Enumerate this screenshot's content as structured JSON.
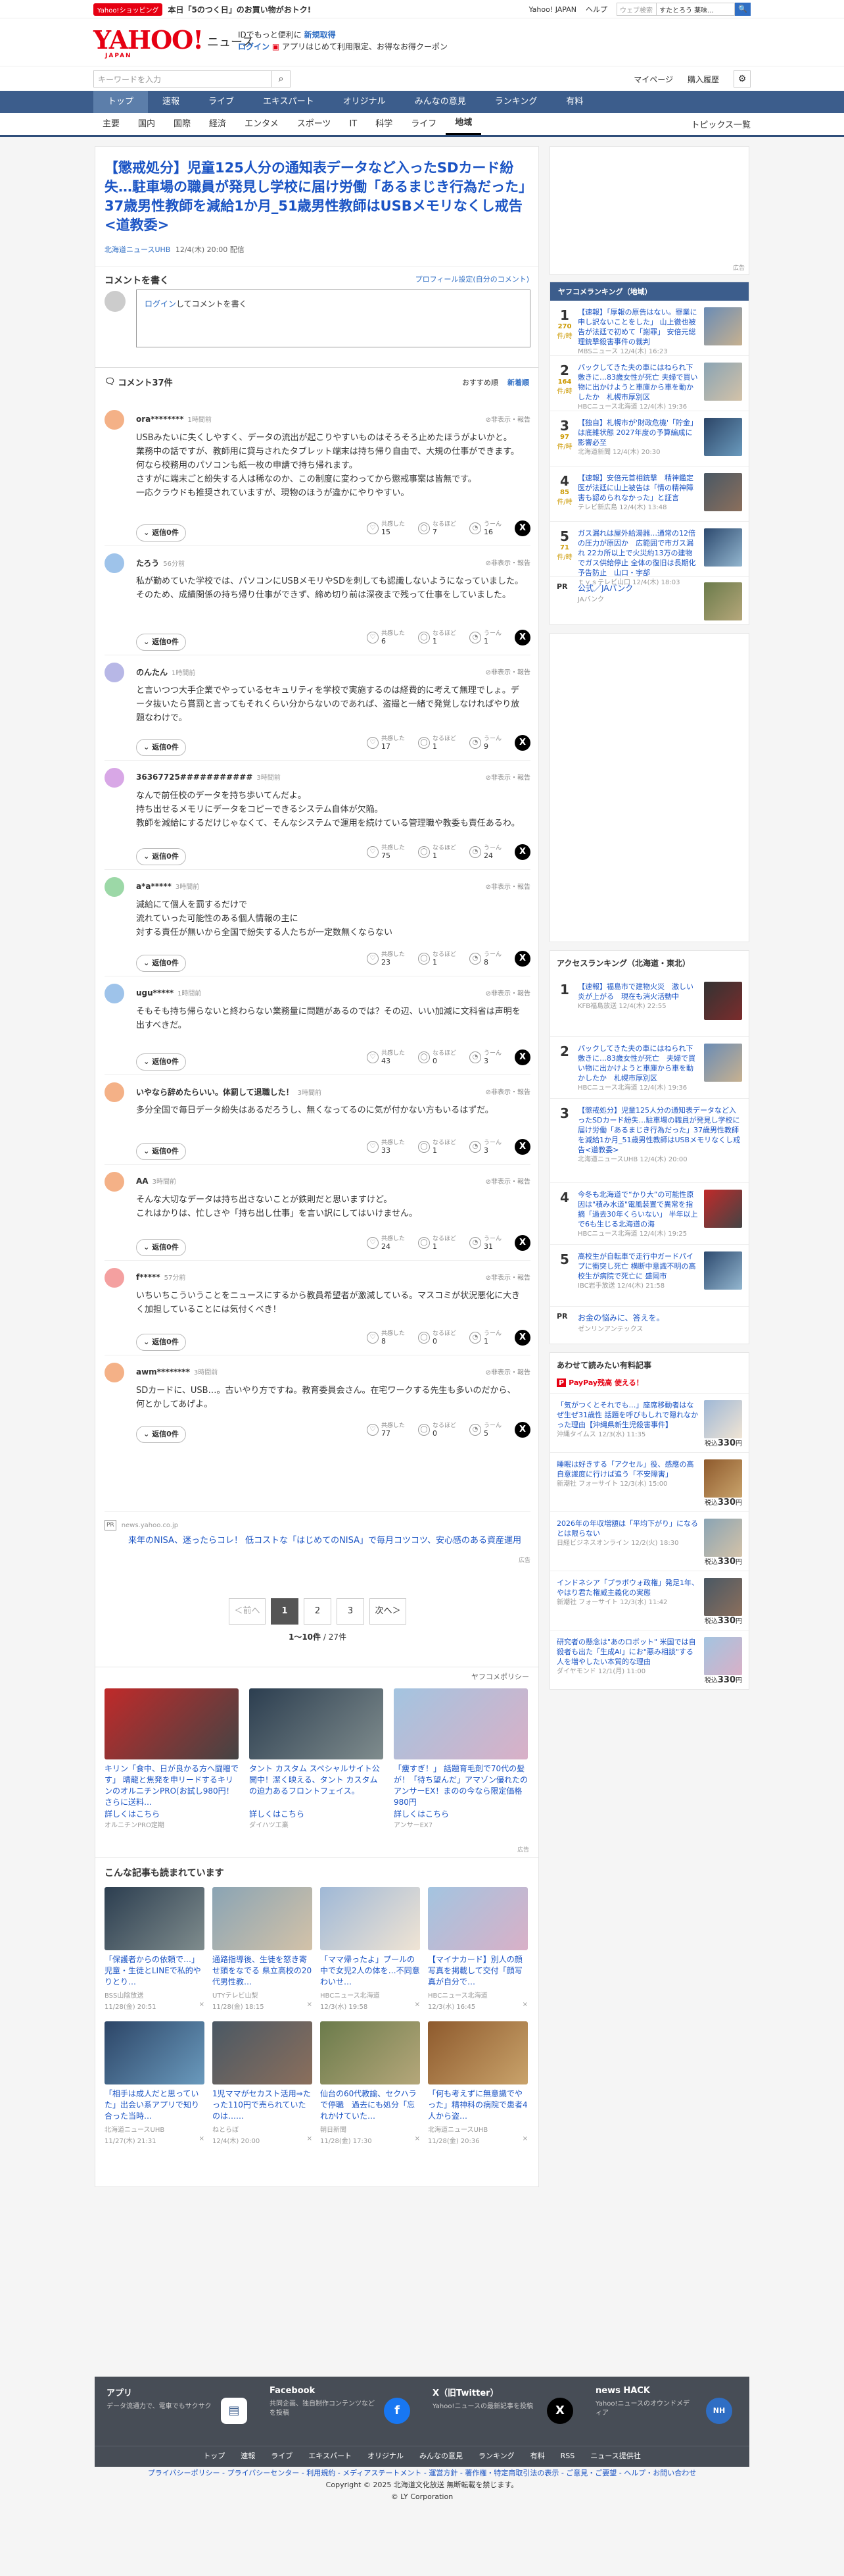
{
  "promo": {
    "tag": "Yahoo!ショッピング",
    "text": "本日「5のつく日」のお買い物がおトク!"
  },
  "topbar": {
    "link1": "Yahoo! JAPAN",
    "link2": "ヘルプ",
    "search_ph": "ウェブ検索",
    "search_value": "すたとろう 薬味…",
    "search_btn": "🔍"
  },
  "header": {
    "logo": "YAHOO!",
    "logo_sub": "JAPAN",
    "service": "ニュース",
    "msg1": "IDでもっと便利に",
    "msg1b": "新規取得",
    "msg2a": "ログイン",
    "msg2b": "アプリはじめて利用限定、お得なお得クーポン"
  },
  "search": {
    "placeholder": "キーワードを入力",
    "mypage": "マイページ",
    "history": "購入履歴"
  },
  "gnav": [
    "トップ",
    "速報",
    "ライブ",
    "エキスパート",
    "オリジナル",
    "みんなの意見",
    "ランキング",
    "有料"
  ],
  "snav": [
    "主要",
    "国内",
    "国際",
    "経済",
    "エンタメ",
    "スポーツ",
    "IT",
    "科学",
    "ライフ",
    "地域"
  ],
  "snav_right": "トピックス一覧",
  "article": {
    "title": "【懲戒処分】児童125人分の通知表データなど入ったSDカード紛失…駐車場の職員が発見し学校に届け労働「あるまじき行為だった」37歳男性教師を減給1か月_51歳男性教師はUSBメモリなくし戒告<道教委>",
    "source": "北海道ニュースUHB",
    "date": "12/4(木) 20:00",
    "kind": "配信"
  },
  "compose": {
    "head": "コメントを書く",
    "profile": "プロフィール設定(自分のコメント)",
    "login": "ログイン",
    "rest": "してコメントを書く"
  },
  "clist": {
    "title": "コメント37件",
    "sort1": "おすすめ順",
    "sort2": "新着順"
  },
  "labels": {
    "reply": "返信0件",
    "report": "非表示・報告",
    "like": "共感した",
    "hmm": "なるほど",
    "well": "うーん",
    "pr": "PR"
  },
  "comments": [
    {
      "name": "ora********",
      "time": "1時間前",
      "color": "#f4b187",
      "body": "USBみたいに失くしやすく、データの流出が起こりやすいものはそろそろ止めたほうがよいかと。\n業務中の話ですが、教師用に貸与されたタブレット端末は持ち帰り自由で、大規の仕事ができます。何なら校務用のパソコンも紙一枚の申請で持ち帰れます。\nさすがに端末ごと紛失する人は稀なのか、この制度に変わってから懲戒事案は皆無です。\n一応クラウドも推奨されていますが、現物のほうが違かにやりやすい。",
      "likes": "15",
      "hmm": "7",
      "well": "16"
    },
    {
      "name": "たろう",
      "time": "56分前",
      "color": "#9ec3ea",
      "body": "私が勤めていた学校では、パソコンにUSBメモリやSDを刺しても認識しないようになっていました。\nそのため、成績関係の持ち帰り仕事ができず、締め切り前は深夜まで残って仕事をしていました。",
      "likes": "6",
      "hmm": "1",
      "well": "1"
    },
    {
      "name": "のんたん",
      "time": "1時間前",
      "color": "#b7b7e6",
      "body": "と言いつつ大手企業でやっているセキュリティを学校で実施するのは経費的に考えて無理でしょ。データ抜いたら賞罰と言ってもそれくらい分からないのであれば、盗撮と一緒で発覚しなければやり放題なわけで。",
      "likes": "17",
      "hmm": "1",
      "well": "9"
    },
    {
      "name": "36367725###########",
      "time": "3時間前",
      "color": "#d8a7e6",
      "body": "なんで前任校のデータを持ち歩いてんだよ。\n持ち出せるメモリにデータをコピーできるシステム自体が欠陥。\n教師を減給にするだけじゃなくて、そんなシステムで運用を続けている管理職や教委も責任あるわ。",
      "likes": "75",
      "hmm": "1",
      "well": "24"
    },
    {
      "name": "a*a*****",
      "time": "3時間前",
      "color": "#9cd8a7",
      "body": "減給にて個人を罰するだけで\n流れていった可能性のある個人情報の主に\n対する責任が無いから全国で紛失する人たちが一定数無くならない",
      "likes": "23",
      "hmm": "1",
      "well": "8"
    },
    {
      "name": "ugu*****",
      "time": "1時間前",
      "color": "#9ec3ea",
      "body": "そもそも持ち帰らないと終わらない業務量に問題があるのでは？その辺、いい加減に文科省は声明を出すべきだ。",
      "likes": "43",
      "hmm": "0",
      "well": "3"
    },
    {
      "name": "いやなら辞めたらいい。体罰して退職した！",
      "time": "3時間前",
      "color": "#f4b187",
      "body": "多分全国で毎日データ紛失はあるだろうし、無くなってるのに気が付かない方もいるはずだ。",
      "likes": "33",
      "hmm": "1",
      "well": "3"
    },
    {
      "name": "AA",
      "time": "3時間前",
      "color": "#f4b187",
      "body": "そんな大切なデータは持ち出さないことが鉄則だと思いますけど。\nこれはかりは、忙しさや「持ち出し仕事」を言い訳にしてはいけません。",
      "likes": "24",
      "hmm": "1",
      "well": "31"
    },
    {
      "name": "f*****",
      "time": "57分前",
      "color": "#f4a0a0",
      "body": "いちいちこういうことをニュースにするから教員希望者が激減している。マスコミが状況悪化に大きく加担していることには気付くべき！",
      "likes": "8",
      "hmm": "0",
      "well": "1"
    },
    {
      "name": "awm********",
      "time": "3時間前",
      "color": "#f4b187",
      "body": "SDカードに、USB…。古いやり方ですね。教育委員会さん。在宅ワークする先生も多いのだから、何とかしてあげよ。",
      "likes": "77",
      "hmm": "0",
      "well": "5"
    }
  ],
  "ad1": {
    "domain": "news.yahoo.co.jp",
    "text": "来年のNISA、迷ったらコレ！ 低コストな「はじめてのNISA」で毎月コツコツ、安心感のある資産運用",
    "pr": "広告"
  },
  "pager": {
    "prev": "＜前へ",
    "next": "次へ＞",
    "p1": "1",
    "p2": "2",
    "p3": "3",
    "count": "1〜10件",
    "total": "27件"
  },
  "policy": "ヤフコメポリシー",
  "ads": [
    {
      "title": "キリン「食中、日が良かる方へ闘贈です」 晴龍と焦発を申リードするキリンのオルニチンPRO(お試し980円！さらに送料…",
      "link": "詳しくはこちら",
      "by": "オルニチンPRO定期",
      "theme": "g6"
    },
    {
      "title": "タント カスタム スペシャルサイト公開中！潔く映える、タント カスタムの迫力あるフロントフェイス。",
      "link": "詳しくはこちら",
      "by": "ダイハツ工業",
      "theme": "g10"
    },
    {
      "title": "「痩すぎ！」 話題育毛剤で70代の髪が！「待ち望んだ」アマゾン優れたのアンサーEX！まのの今なら限定価格980円",
      "link": "詳しくはこちら",
      "by": "アンサーEX7",
      "theme": "g11"
    }
  ],
  "adlabel": "広告",
  "read": {
    "head": "こんな記事も読まれています",
    "items": [
      {
        "title": "「保護者からの依頼で…」児童・生徒とLINEで私的やりとり…",
        "src": "BSS山陰放送",
        "date": "11/28(金) 20:51"
      },
      {
        "title": "通路指導後、生徒を怒き寄せ頭をなでる 県立高校の20代男性教…",
        "src": "UTYテレビ山梨",
        "date": "11/28(金) 18:15"
      },
      {
        "title": "「ママ帰ったよ」プールの中で女児2人の体を…不同意わいせ…",
        "src": "HBCニュース北海道",
        "date": "12/3(水) 19:58"
      },
      {
        "title": "【マイナカード】別人の顔写真を掲載して交付「顔写真が自分で…",
        "src": "HBCニュース北海道",
        "date": "12/3(水) 16:45"
      },
      {
        "title": "「相手は成人だと思っていた」出会い系アプリで知り合った当時…",
        "src": "北海道ニュースUHB",
        "date": "11/27(木) 21:31"
      },
      {
        "title": "1児ママがセカスト活用⇒たった110円で売られていたのは……",
        "src": "ねとらぼ",
        "date": "12/4(木) 20:00"
      },
      {
        "title": "仙台の60代教諭、セクハラで停職　過去にも処分「忘れかけていた…",
        "src": "朝日新聞",
        "date": "11/28(金) 17:30"
      },
      {
        "title": "「何も考えずに無意識でやった」精神科の病院で患者4人から盗…",
        "src": "北海道ニュースUHB",
        "date": "11/28(金) 20:36"
      }
    ]
  },
  "side": {
    "ad_label": "広告",
    "r1_head": "ヤフコメランキング（地域）",
    "r1": [
      {
        "n": "1",
        "count": "270",
        "unit": "件/時",
        "text": "【速報】「厚報の原告はない。罪業に申し訳ないことをした」 山上徹也被告が法廷で初めて「謝罪」 安倍元総理銃撃殺害事件の裁判",
        "src": "MBSニュース 12/4(木) 16:23"
      },
      {
        "n": "2",
        "count": "164",
        "unit": "件/時",
        "text": "パックしてきた夫の車にはねられ下敷きに…83歳女性が死亡 夫婦で買い物に出かけようと車庫から車を動かしたか　札幌市厚別区",
        "src": "HBCニュース北海道 12/4(木) 19:36"
      },
      {
        "n": "3",
        "count": "97",
        "unit": "件/時",
        "text": "【独自】札幌市が'財政危機'「貯金」は底雑状態 2027年度の予算編成に影響必至",
        "src": "北海道新聞 12/4(木) 20:30"
      },
      {
        "n": "4",
        "count": "85",
        "unit": "件/時",
        "text": "【速報】安倍元首相銃撃　精神鑑定医が法廷に山上被告は「情の精神障害も認められなかった」と証言",
        "src": "テレビ新広島 12/4(木) 13:48"
      },
      {
        "n": "5",
        "count": "71",
        "unit": "件/時",
        "text": "ガス漏れは屋外給湯器…通常の12倍の圧力が原因か　広範囲で市ガス漏れ 22カ所以上で火災約13万の建物でガス供給停止 全体の復旧は長期化予告防止　山口・宇部",
        "src": "ｔｙｓテレビ山口 12/4(木) 18:03"
      }
    ],
    "pr1": {
      "name": "公式／JAバンク",
      "sub": "JAバンク"
    },
    "r2_head": "アクセスランキング（北海道・東北）",
    "r2": [
      {
        "n": "1",
        "text": "【速報】福島市で建物火災　激しい炎が上がる　現在も消火活動中",
        "src": "KFB福島放送 12/4(木) 22:55"
      },
      {
        "n": "2",
        "text": "パックしてきた夫の車にはねられ下敷きに…83歳女性が死亡　夫婦で買い物に出かけようと車庫から車を動かしたか　札幌市厚別区",
        "src": "HBCニュース北海道 12/4(木) 19:36"
      },
      {
        "n": "3",
        "text": "【懲戒処分】児童125人分の通知表データなど入ったSDカード紛失…駐車場の職員が発見し学校に届け労働「あるまじき行為だった」37歳男性教師を減給1か月_51歳男性教師はUSBメモリなくし戒告<道教委>",
        "src": "北海道ニュースUHB 12/4(木) 20:00"
      },
      {
        "n": "4",
        "text": "今冬も北海道で“かり大”の可能性原因は\"積み水道\"電風装置で異常を指摘「過去30年くらいない」 半年以上で6も生じる北海道の海",
        "src": "HBCニュース北海道 12/4(木) 19:25"
      },
      {
        "n": "5",
        "text": "高校生が自転車で走行中ガードパイプに衝突し死亡 横断中意識不明の高校生が病院で死亡に 盛岡市",
        "src": "IBC岩手放送 12/4(木) 21:58"
      }
    ],
    "pr2": {
      "name": "お金の悩みに、答えを。",
      "sub": "ゼンリンアンテックス"
    },
    "r3_head": "あわせて読みたい有料記事",
    "paypay": "PayPay残高 使える！",
    "paid": [
      {
        "title": "「気がつくとそれでも…」座席移動者はなぜ生ぜ31歳性 話題を呼びもしれで隠れなかった理由【沖縄県新生児殺害事件】",
        "src": "沖縄タイムス 12/3(水) 11:35",
        "price": "330"
      },
      {
        "title": "睡眠は好きする「アクセル」役、感應の高自意識度に行けば追う「不安障害」",
        "src": "新潮社 フォーサイト 12/3(水) 15:00",
        "price": "330"
      },
      {
        "title": "2026年の年収増額は「平均下がり」になるとは限らない",
        "src": "日経ビジネスオンライン 12/2(火) 18:30",
        "price": "330"
      },
      {
        "title": "インドネシア「プラボウォ政権」発足1年、やはり君た権威主義化の実態",
        "src": "新潮社 フォーサイト 12/3(水) 11:42",
        "price": "330"
      },
      {
        "title": "研究者の懸念は\"あのロボット\" 米国では自殺者も出た「生成AI」にお\"悪み相談\"する人を増やしたい本質的な理由",
        "src": "ダイヤモンド 12/1(月) 11:00",
        "price": "330"
      }
    ],
    "price_prefix": "税込",
    "price_unit": "円"
  },
  "footer": {
    "app_t": "アプリ",
    "app_d": "データ流通力で、電車でもサクサク",
    "fb_t": "Facebook",
    "fb_d": "共同企画、独自制作コンテンツなどを投稿",
    "x_t": "X（旧Twitter）",
    "x_d": "Yahoo!ニュースの最新記事を投稿",
    "hack_t": "news HACK",
    "hack_d": "Yahoo!ニュースのオウンドメディア",
    "nav": [
      "トップ",
      "速報",
      "ライブ",
      "エキスパート",
      "オリジナル",
      "みんなの意見",
      "ランキング",
      "有料",
      "RSS",
      "ニュース提供社"
    ],
    "legal1": "プライバシーポリシー - プライバシーセンター - 利用規約 - メディアステートメント - 運営方針 - 著作権・特定商取引法の表示 - ご意見・ご要望 - ヘルプ・お問い合わせ",
    "legal2": "Copyright © 2025 北海道文化放送 無断転載を禁じます。",
    "legal3": "© LY Corporation"
  }
}
